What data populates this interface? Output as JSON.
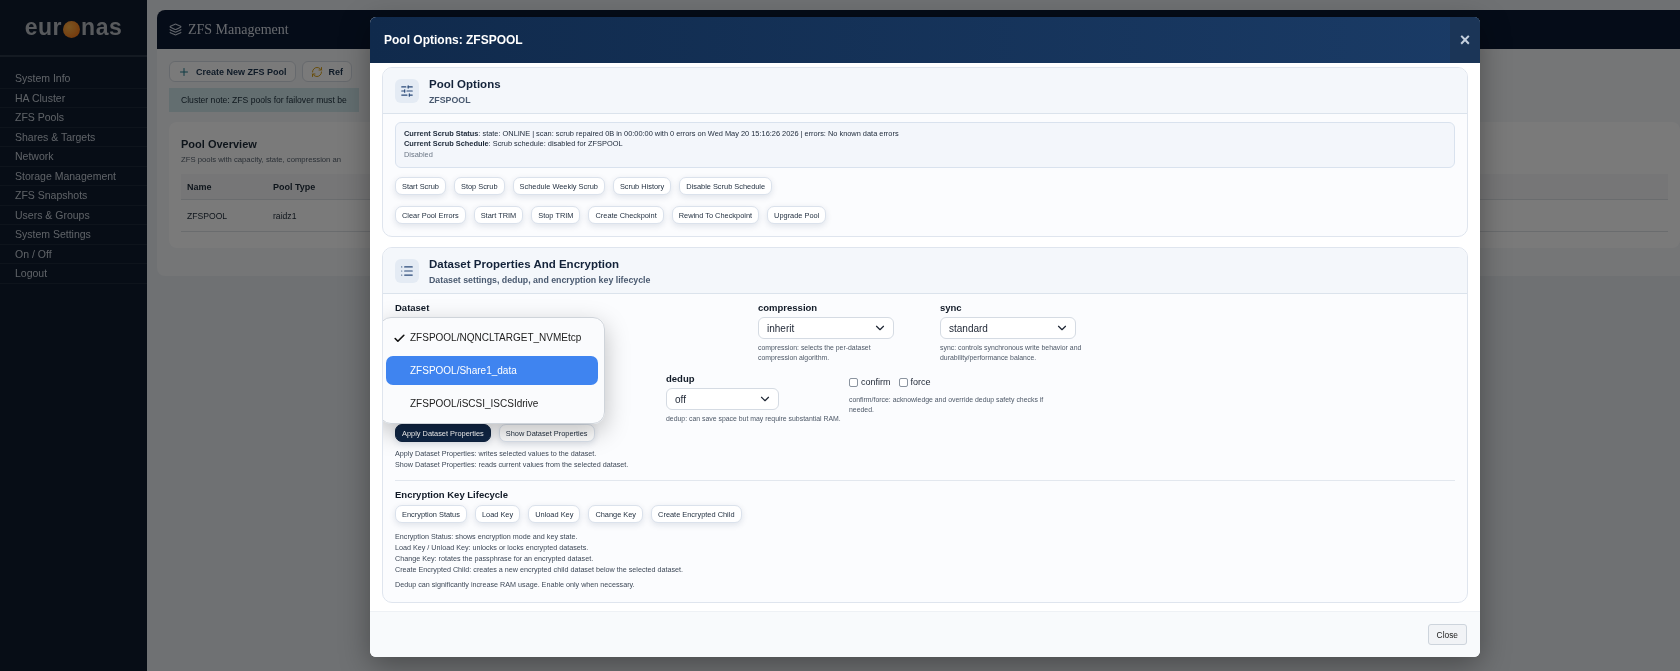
{
  "sidebar": {
    "logo": {
      "left": "eur",
      "right": "nas"
    },
    "items": [
      {
        "label": "System Info"
      },
      {
        "label": "HA Cluster"
      },
      {
        "label": "ZFS Pools"
      },
      {
        "label": "Shares & Targets"
      },
      {
        "label": "Network"
      },
      {
        "label": "Storage Management"
      },
      {
        "label": "ZFS Snapshots"
      },
      {
        "label": "Users & Groups"
      },
      {
        "label": "System Settings"
      },
      {
        "label": "On / Off"
      },
      {
        "label": "Logout"
      }
    ]
  },
  "page": {
    "title": "ZFS Management",
    "toolbar": [
      {
        "label": "Create New ZFS Pool",
        "kind": "create"
      },
      {
        "label": "Ref",
        "kind": "refresh"
      }
    ],
    "note": "Cluster note: ZFS pools for failover must be",
    "overview": {
      "title": "Pool Overview",
      "subtitle": "ZFS pools with capacity, state, compression an",
      "columns": [
        "Name",
        "Pool Type"
      ],
      "rows": [
        [
          "ZFSPOOL",
          "raidz1"
        ]
      ]
    }
  },
  "modal": {
    "title": "Pool Options: ZFSPOOL",
    "close": "×",
    "pool_card": {
      "title": "Pool Options",
      "subtitle": "ZFSPOOL",
      "status_lines": [
        "**Current Scrub Status**: state: ONLINE | scan: scrub repaired 0B in 00:00:00 with 0 errors on Wed May 20 15:16:26 2026 | errors: No known data errors",
        "**Current Scrub Schedule**: Scrub schedule: disabled for ZFSPOOL"
      ],
      "status_note": "Disabled",
      "action_rows": [
        [
          "Start Scrub",
          "Stop Scrub",
          "Schedule Weekly Scrub",
          "Scrub History",
          "Disable Scrub Schedule"
        ],
        [
          "Clear Pool Errors",
          "Start TRIM",
          "Stop TRIM",
          "Create Checkpoint",
          "Rewind To Checkpoint",
          "Upgrade Pool"
        ]
      ]
    },
    "dataset_card": {
      "title": "Dataset Properties And Encryption",
      "subtitle": "Dataset settings, dedup, and encryption key lifecycle",
      "dataset": {
        "label": "Dataset",
        "options": [
          {
            "label": "ZFSPOOL/NQNCLTARGET_NVMEtcp",
            "selected": true,
            "highlighted": false
          },
          {
            "label": "ZFSPOOL/Share1_data",
            "selected": false,
            "highlighted": true
          },
          {
            "label": "ZFSPOOL/iSCSI_ISCSIdrive",
            "selected": false,
            "highlighted": false
          }
        ]
      },
      "compression": {
        "label": "compression",
        "value": "inherit",
        "help": "compression: selects the per-dataset compression algorithm."
      },
      "sync": {
        "label": "sync",
        "value": "standard",
        "help": "sync: controls synchronous write behavior and durability/performance balance."
      },
      "dedup": {
        "label": "dedup",
        "value": "off",
        "help": "dedup: can save space but may require substantial RAM."
      },
      "flags": [
        {
          "label": "confirm",
          "checked": false
        },
        {
          "label": "force",
          "checked": false
        }
      ],
      "flags_help": "confirm/force: acknowledge and override dedup safety checks if needed.",
      "buttons": [
        {
          "label": "Apply Dataset Properties",
          "primary": true
        },
        {
          "label": "Show Dataset Properties",
          "primary": false
        }
      ],
      "help_lines": [
        "Apply Dataset Properties: writes selected values to the dataset.",
        "Show Dataset Properties: reads current values from the selected dataset."
      ],
      "encryption": {
        "title": "Encryption Key Lifecycle",
        "buttons": [
          "Encryption Status",
          "Load Key",
          "Unload Key",
          "Change Key",
          "Create Encrypted Child"
        ],
        "help_lines": [
          "Encryption Status: shows encryption mode and key state.",
          "Load Key / Unload Key: unlocks or locks encrypted datasets.",
          "Change Key: rotates the passphrase for an encrypted dataset.",
          "Create Encrypted Child: creates a new encrypted child dataset below the selected dataset."
        ],
        "note": "Dedup can significantly increase RAM usage. Enable only when necessary."
      }
    },
    "footer": {
      "close_label": "Close"
    }
  }
}
